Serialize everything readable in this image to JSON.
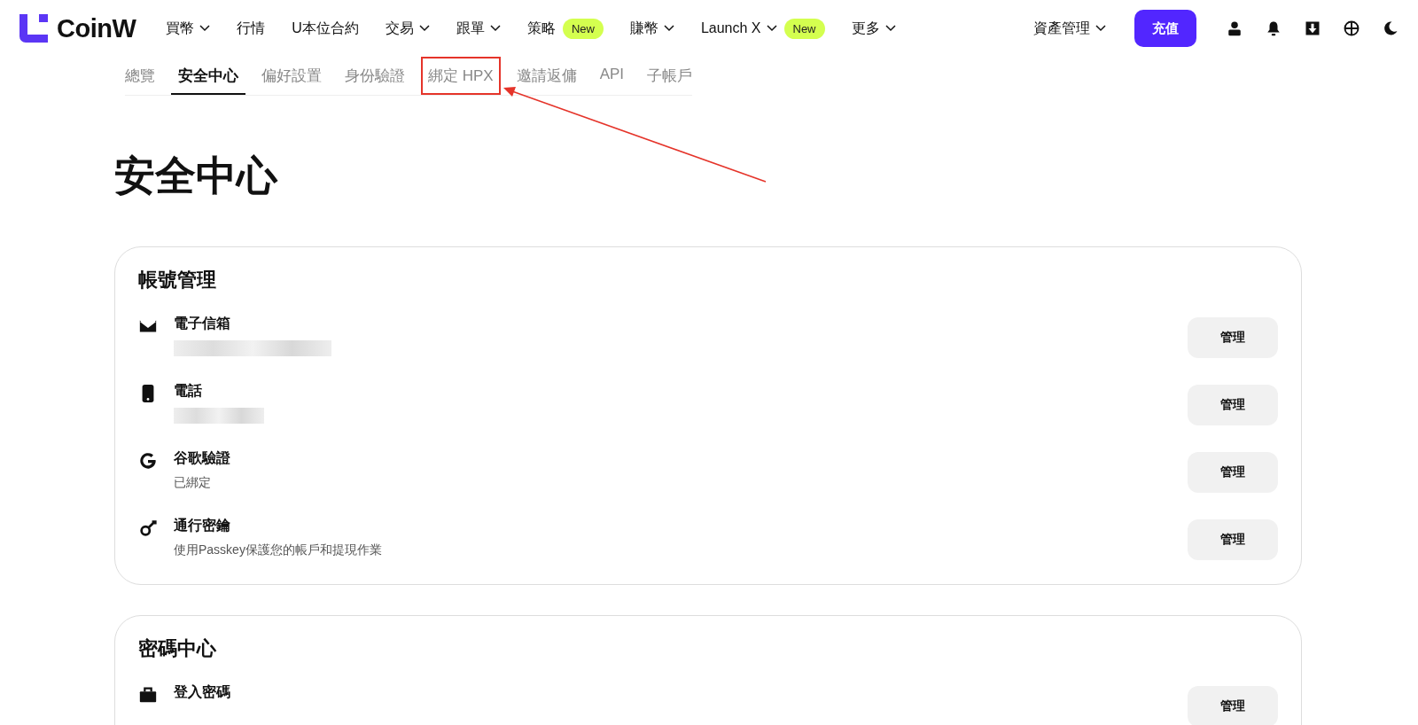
{
  "brand": {
    "name": "CoinW"
  },
  "nav": [
    {
      "label": "買幣",
      "dropdown": true
    },
    {
      "label": "行情",
      "dropdown": false
    },
    {
      "label": "U本位合約",
      "dropdown": false
    },
    {
      "label": "交易",
      "dropdown": true
    },
    {
      "label": "跟單",
      "dropdown": true
    },
    {
      "label": "策略",
      "dropdown": false,
      "badge": "New"
    },
    {
      "label": "賺幣",
      "dropdown": true
    },
    {
      "label": "Launch X",
      "dropdown": true,
      "badge": "New"
    },
    {
      "label": "更多",
      "dropdown": true
    }
  ],
  "asset_menu": {
    "label": "資產管理"
  },
  "deposit_button": {
    "label": "充值"
  },
  "toolbar_icons": [
    {
      "kind": "user"
    },
    {
      "kind": "bell"
    },
    {
      "kind": "download"
    },
    {
      "kind": "globe"
    },
    {
      "kind": "moon"
    }
  ],
  "tabs": [
    {
      "label": "總覽",
      "selected": false,
      "highlighted": false
    },
    {
      "label": "安全中心",
      "selected": true,
      "highlighted": false
    },
    {
      "label": "偏好設置",
      "selected": false,
      "highlighted": false
    },
    {
      "label": "身份驗證",
      "selected": false,
      "highlighted": false
    },
    {
      "label": "綁定 HPX",
      "selected": false,
      "highlighted": true
    },
    {
      "label": "邀請返傭",
      "selected": false,
      "highlighted": false
    },
    {
      "label": "API",
      "selected": false,
      "highlighted": false
    },
    {
      "label": "子帳戶",
      "selected": false,
      "highlighted": false
    }
  ],
  "page_title": "安全中心",
  "sections": [
    {
      "title": "帳號管理",
      "items": [
        {
          "kind": "mail",
          "label": "電子信箱",
          "redacted": true,
          "button": "管理"
        },
        {
          "kind": "phone",
          "label": "電話",
          "redacted": true,
          "button": "管理"
        },
        {
          "kind": "google",
          "label": "谷歌驗證",
          "detail": "已綁定",
          "redacted": false,
          "button": "管理"
        },
        {
          "kind": "key",
          "label": "通行密鑰",
          "detail": "使用Passkey保護您的帳戶和提現作業",
          "redacted": false,
          "button": "管理"
        }
      ]
    },
    {
      "title": "密碼中心",
      "items": [
        {
          "kind": "lock",
          "label": "登入密碼",
          "redacted": false,
          "button": "管理"
        }
      ]
    }
  ]
}
